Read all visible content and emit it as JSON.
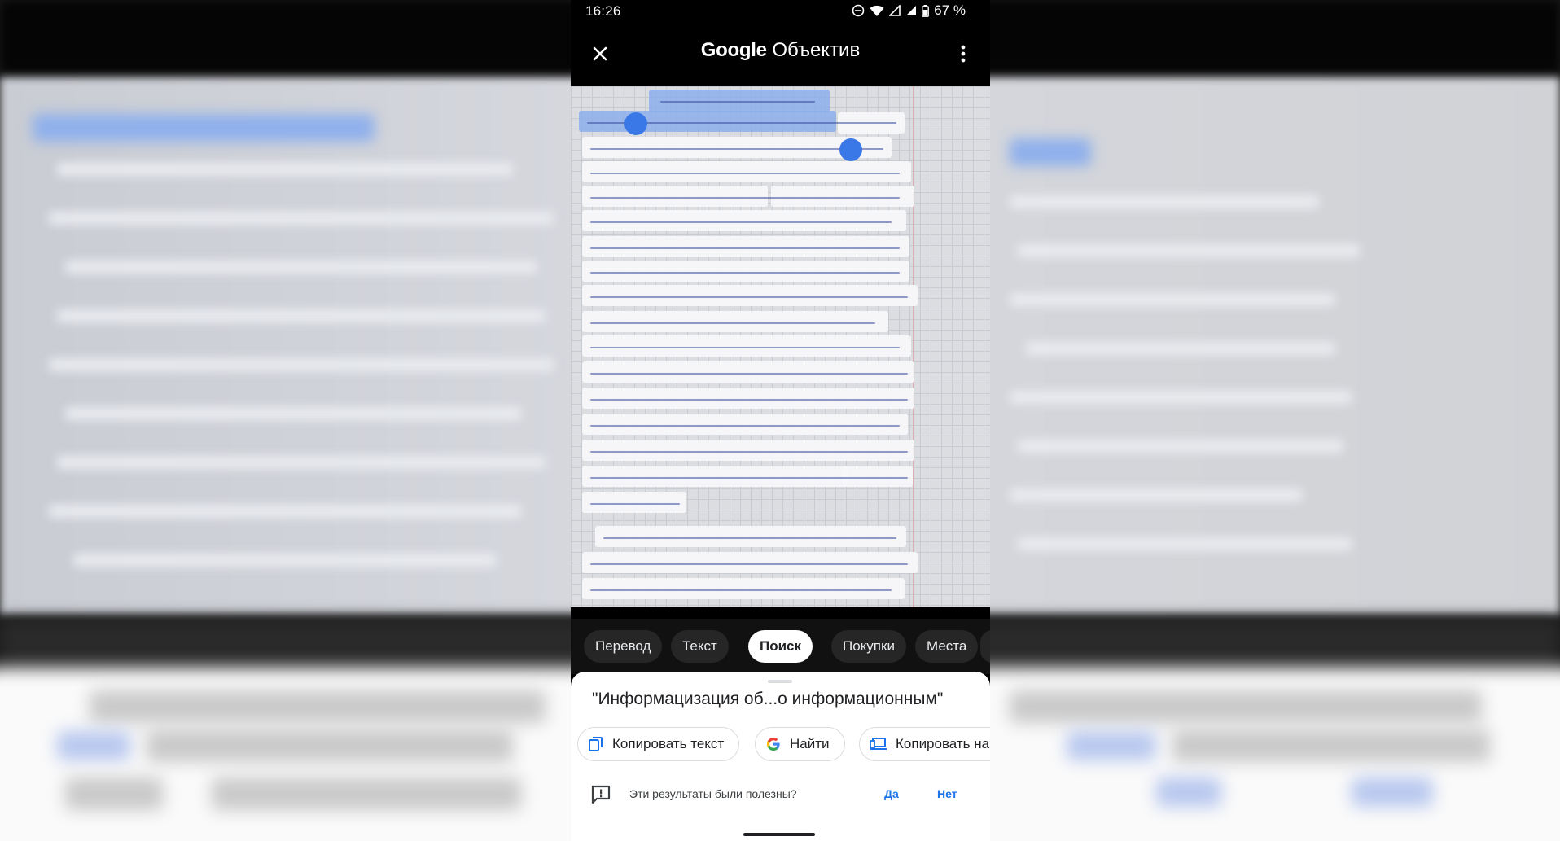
{
  "status_bar": {
    "time": "16:26",
    "battery": "67 %"
  },
  "app_bar": {
    "title_brand": "Google",
    "title_product": "Объектив"
  },
  "modes": [
    {
      "label": "Перевод"
    },
    {
      "label": "Текст"
    },
    {
      "label": "Поиск"
    },
    {
      "label": "Покупки"
    },
    {
      "label": "Места"
    }
  ],
  "active_mode": "Поиск",
  "result": {
    "query": "\"Информацизация об...о информационным\"",
    "actions": {
      "copy_text": "Копировать текст",
      "search": "Найти",
      "copy_to": "Копировать на к"
    }
  },
  "feedback": {
    "question": "Эти результаты были полезны?",
    "yes": "Да",
    "no": "Нет"
  },
  "icons": {
    "close": "close-icon",
    "more": "more-vert-icon",
    "copy": "copy-icon",
    "google": "google-g-icon",
    "computer": "computer-icon",
    "feedback": "feedback-icon"
  },
  "colors": {
    "accent": "#1a73e8",
    "selection": "#8cafeb",
    "handle": "#3b78e7"
  }
}
